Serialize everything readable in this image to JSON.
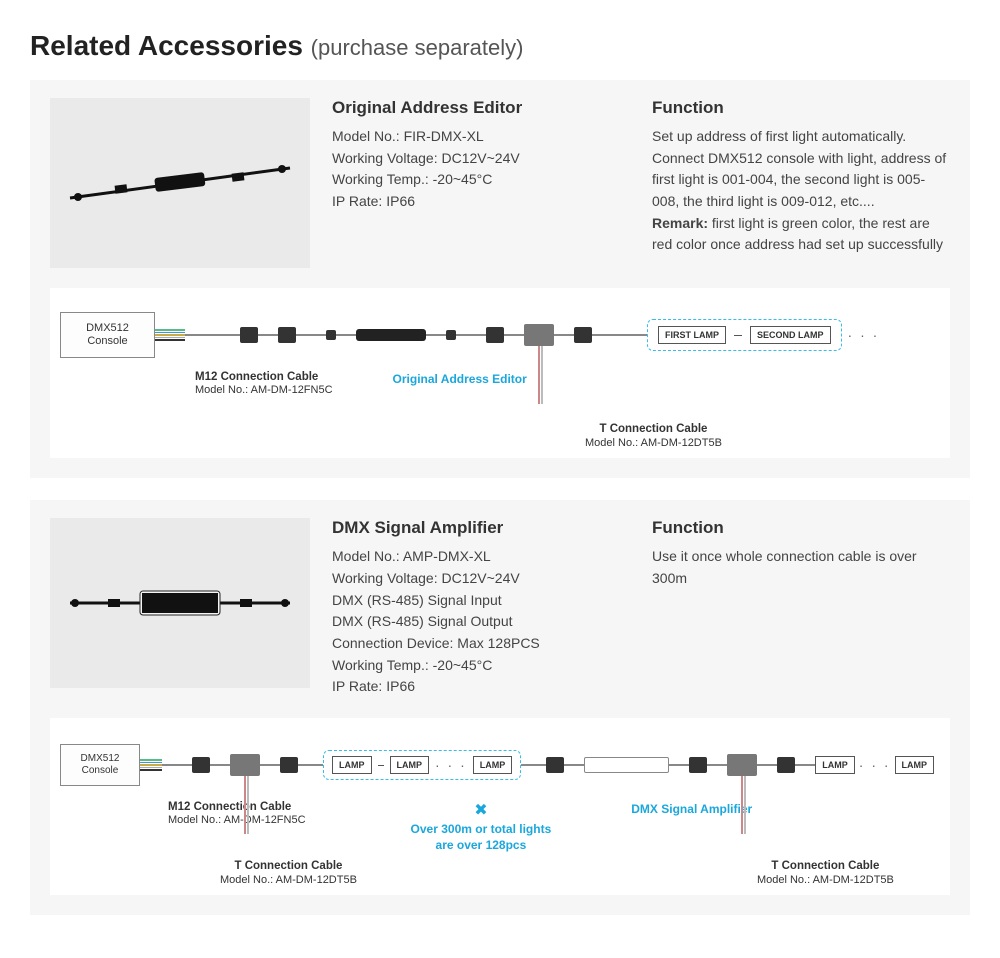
{
  "heading_main": "Related Accessories",
  "heading_sub": "(purchase separately)",
  "product1": {
    "title": "Original Address Editor",
    "specs": [
      "Model No.: FIR-DMX-XL",
      "Working Voltage: DC12V~24V",
      "Working Temp.: -20~45°C",
      "IP Rate: IP66"
    ],
    "func_title": "Function",
    "func_body": "Set up address of first light automatically.\nConnect DMX512 console with light, address of first light is 001-004, the second light is 005-008, the third light is 009-012, etc....",
    "func_remark_label": "Remark:",
    "func_remark_body": " first light is green color, the rest are red color once address had set up successfully"
  },
  "diagram1": {
    "console": "DMX512\nConsole",
    "m12_title": "M12 Connection Cable",
    "m12_model": "Model No.: AM-DM-12FN5C",
    "editor_label": "Original Address Editor",
    "t_title": "T Connection Cable",
    "t_model": "Model No.: AM-DM-12DT5B",
    "first_lamp": "FIRST LAMP",
    "second_lamp": "SECOND LAMP",
    "dots": "· · ·"
  },
  "product2": {
    "title": "DMX Signal Amplifier",
    "specs": [
      "Model No.: AMP-DMX-XL",
      "Working Voltage: DC12V~24V",
      "DMX (RS-485) Signal Input",
      "DMX (RS-485) Signal Output",
      "Connection Device: Max 128PCS",
      "Working Temp.: -20~45°C",
      "IP Rate: IP66"
    ],
    "func_title": "Function",
    "func_body": "Use it once whole connection cable is over 300m"
  },
  "diagram2": {
    "console": "DMX512\nConsole",
    "m12_title": "M12 Connection Cable",
    "m12_model": "Model No.: AM-DM-12FN5C",
    "t_title": "T Connection Cable",
    "t_model": "Model No.: AM-DM-12DT5B",
    "lamp": "LAMP",
    "note_line1": "Over 300m or total lights",
    "note_line2": "are over 128pcs",
    "amp_label": "DMX Signal Amplifier",
    "dots": "· · ·"
  }
}
